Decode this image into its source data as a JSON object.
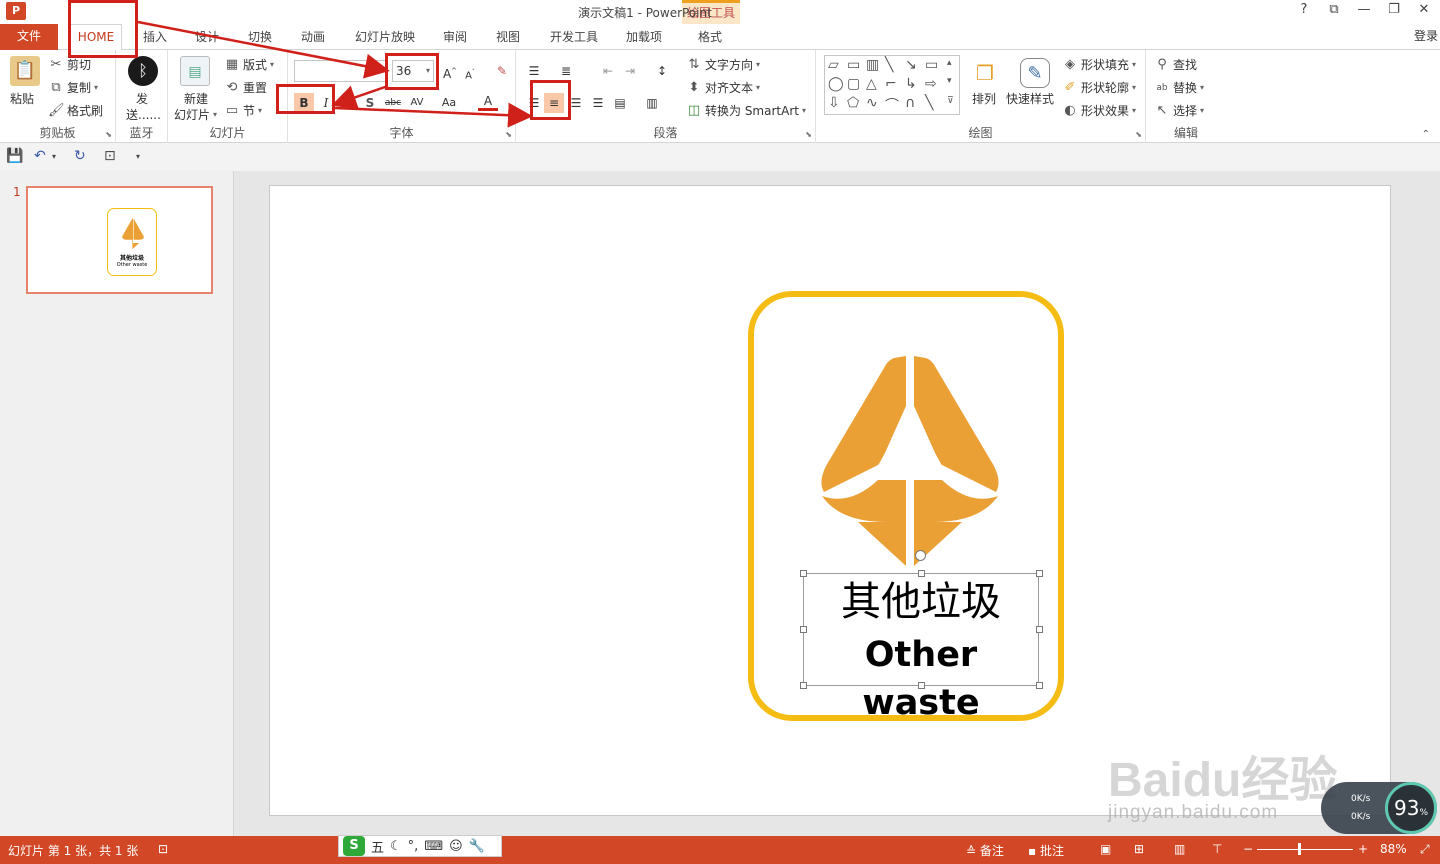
{
  "window": {
    "title": "演示文稿1 - PowerPoint",
    "app_icon": "P",
    "context_group": "绘图工具",
    "controls": [
      "?",
      "⧉",
      "—",
      "❐",
      "✕"
    ],
    "login": "登录"
  },
  "tabs": {
    "file": "文件",
    "home": "HOME",
    "insert": "插入",
    "design": "设计",
    "transitions": "切换",
    "animations": "动画",
    "slideshow": "幻灯片放映",
    "review": "审阅",
    "view": "视图",
    "developer": "开发工具",
    "addins": "加载项",
    "format": "格式"
  },
  "ribbon": {
    "clipboard": {
      "label": "剪贴板",
      "paste": "粘贴",
      "cut": "剪切",
      "copy": "复制",
      "painter": "格式刷"
    },
    "bluetooth": {
      "label": "蓝牙",
      "send_line1": "发",
      "send_line2": "送......"
    },
    "slides": {
      "label": "幻灯片",
      "new_line1": "新建",
      "new_line2": "幻灯片",
      "layout": "版式",
      "reset": "重置",
      "section": "节"
    },
    "font": {
      "label": "字体",
      "font_name": "",
      "size": "36",
      "bold": "B",
      "italic": "I",
      "underline": "U",
      "shadow": "S",
      "strike": "abc",
      "spacing": "AV",
      "case": "Aa",
      "color": "A"
    },
    "paragraph": {
      "label": "段落",
      "text_direction": "文字方向",
      "align_text": "对齐文本",
      "smartart": "转换为 SmartArt"
    },
    "drawing": {
      "label": "绘图",
      "arrange": "排列",
      "quick_styles": "快速样式",
      "fill": "形状填充",
      "outline": "形状轮廓",
      "effects": "形状效果"
    },
    "editing": {
      "label": "编辑",
      "find": "查找",
      "replace": "替换",
      "select": "选择"
    }
  },
  "thumbnails": [
    {
      "number": "1",
      "title_cn": "其他垃圾",
      "title_en": "Other waste"
    }
  ],
  "slide": {
    "title_cn": "其他垃圾",
    "title_en": "Other waste",
    "icon": "recycle-triangle-arrow-icon",
    "colors": {
      "border": "#f5bd14",
      "icon": "#eba035"
    }
  },
  "watermark": {
    "logo": "Baidu经验",
    "url": "jingyan.baidu.com"
  },
  "net_widget": {
    "up": "0K/s",
    "down": "0K/s",
    "percent": "93",
    "unit": "%"
  },
  "ime": {
    "logo": "S",
    "mode": "五"
  },
  "statusbar": {
    "slide_info": "幻灯片 第 1 张，共 1 张",
    "notes": "备注",
    "comments": "批注",
    "zoom": "88%"
  },
  "colors": {
    "accent": "#d24726",
    "highlight": "#d0201a"
  }
}
